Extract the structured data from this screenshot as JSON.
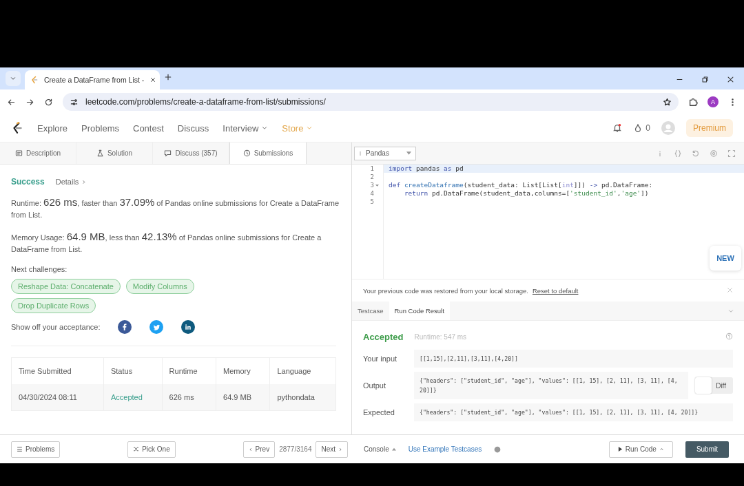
{
  "browser": {
    "tab_title": "Create a DataFrame from List -",
    "url": "leetcode.com/problems/create-a-dataframe-from-list/submissions/",
    "profile_initial": "A"
  },
  "nav": {
    "links": [
      {
        "label": "Explore",
        "kind": "link"
      },
      {
        "label": "Problems",
        "kind": "link"
      },
      {
        "label": "Contest",
        "kind": "link"
      },
      {
        "label": "Discuss",
        "kind": "link"
      },
      {
        "label": "Interview",
        "kind": "dropdown"
      },
      {
        "label": "Store",
        "kind": "store"
      }
    ],
    "streak": "0",
    "premium": "Premium"
  },
  "panel_tabs": [
    {
      "label": "Description",
      "kind": "description",
      "selected": false
    },
    {
      "label": "Solution",
      "kind": "solution",
      "selected": false
    },
    {
      "label": "Discuss (357)",
      "kind": "discuss",
      "selected": false
    },
    {
      "label": "Submissions",
      "kind": "submissions",
      "selected": true
    }
  ],
  "language": "Pandas",
  "result": {
    "status": "Success",
    "details": "Details",
    "runtime_text": "Runtime: **626 ms**, faster than **37.09%** of Pandas online submissions for Create a DataFrame from List.",
    "memory_text": "Memory Usage: **64.9 MB**, less than **42.13%** of Pandas online submissions for Create a DataFrame from List.",
    "next_label": "Next challenges:",
    "challenges": [
      "Reshape Data: Concatenate",
      "Modify Columns",
      "Drop Duplicate Rows"
    ],
    "share_label": "Show off your acceptance:"
  },
  "submissions": {
    "columns": [
      "Time Submitted",
      "Status",
      "Runtime",
      "Memory",
      "Language"
    ],
    "rows": [
      {
        "time": "04/30/2024 08:11",
        "status": "Accepted",
        "runtime": "626 ms",
        "memory": "64.9 MB",
        "language": "pythondata"
      }
    ]
  },
  "editor": {
    "lines": [
      {
        "number": "1",
        "selected": true,
        "fold": false,
        "tokens": [
          {
            "t": "import",
            "kind": "kw"
          },
          {
            "t": " pandas ",
            "kind": "plain"
          },
          {
            "t": "as",
            "kind": "kw"
          },
          {
            "t": " pd",
            "kind": "plain"
          }
        ]
      },
      {
        "number": "2",
        "selected": false,
        "fold": false
      },
      {
        "number": "3",
        "selected": false,
        "fold": true,
        "tokens": [
          {
            "t": "def",
            "kind": "kw"
          },
          {
            "t": " createDataframe",
            "kind": "fn"
          },
          {
            "t": "(student_data: List[List[",
            "kind": "plain"
          },
          {
            "t": "int",
            "kind": "num"
          },
          {
            "t": "]]) ",
            "kind": "plain"
          },
          {
            "t": "->",
            "kind": "kw"
          },
          {
            "t": " pd.DataFrame:",
            "kind": "plain"
          }
        ]
      },
      {
        "number": "4",
        "selected": false,
        "fold": false,
        "tokens": [
          {
            "t": "    return",
            "kind": "kw"
          },
          {
            "t": " pd.DataFrame(student_data,columns=[",
            "kind": "plain"
          },
          {
            "t": "'student_id'",
            "kind": "str"
          },
          {
            "t": ",",
            "kind": "plain"
          },
          {
            "t": "'age'",
            "kind": "str"
          },
          {
            "t": "])",
            "kind": "plain"
          }
        ]
      },
      {
        "number": "5",
        "selected": false,
        "fold": false
      }
    ],
    "new_badge": "NEW"
  },
  "restore": {
    "message": "Your previous code was restored from your local storage.",
    "link": "Reset to default"
  },
  "console_tabs": [
    {
      "label": "Testcase",
      "selected": false
    },
    {
      "label": "Run Code Result",
      "selected": true
    }
  ],
  "run_result": {
    "status": "Accepted",
    "runtime": "Runtime: 547 ms",
    "fields": [
      {
        "label": "Your input",
        "value": "[[1,15],[2,11],[3,11],[4,20]]"
      },
      {
        "label": "Output",
        "value": "{\"headers\": [\"student_id\", \"age\"], \"values\": [[1, 15], [2, 11], [3, 11], [4, 20]]}",
        "diff": {
          "label": "Diff",
          "on": false
        }
      },
      {
        "label": "Expected",
        "value": "{\"headers\": [\"student_id\", \"age\"], \"values\": [[1, 15], [2, 11], [3, 11], [4, 20]]}"
      }
    ]
  },
  "footer": {
    "problems": "Problems",
    "pick_one": "Pick One",
    "prev": "Prev",
    "counter": "2877/3164",
    "next": "Next",
    "console": "Console",
    "use_example": "Use Example Testcases",
    "run_code": "Run Code",
    "submit": "Submit"
  }
}
